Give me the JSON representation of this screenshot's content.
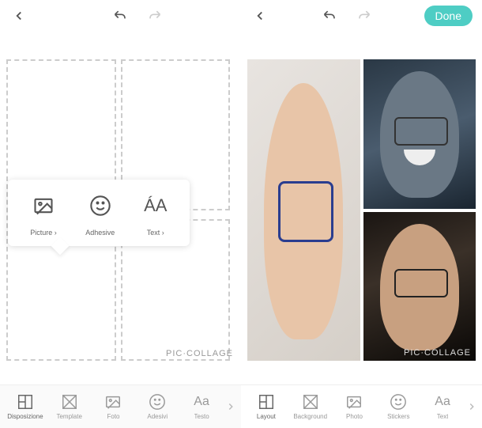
{
  "left": {
    "toolbar": {
      "back": "‹",
      "undo": "↶",
      "redo": "↷"
    },
    "popup": {
      "picture": {
        "label": "Picture ›"
      },
      "adhesive": {
        "label": "Adhesive"
      },
      "text": {
        "label": "Text ›",
        "icon": "ÁA"
      }
    },
    "watermark": "PIC·COLLAGE",
    "tabs": {
      "disposizione": "Disposizione",
      "template": "Template",
      "foto": "Foto",
      "adesivi": "Adesivi",
      "testo": "Testo"
    }
  },
  "right": {
    "toolbar": {
      "share": "‹",
      "undo": "↶",
      "redo": "↷",
      "done": "Done"
    },
    "watermark": "PIC·COLLAGE",
    "tabs": {
      "layout": "Layout",
      "background": "Background",
      "photo": "Photo",
      "stickers": "Stickers",
      "text": "Text",
      "text_icon": "Aa"
    }
  }
}
